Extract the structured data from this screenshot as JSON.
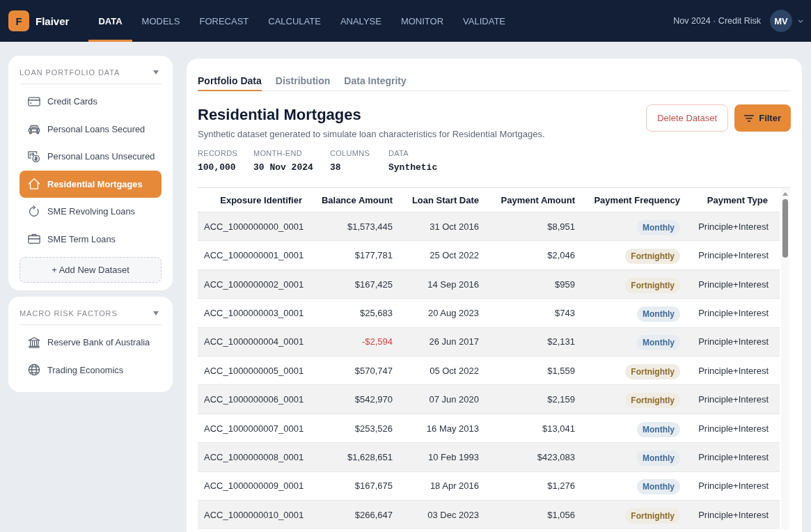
{
  "top_nav": {
    "logo": {
      "letter": "F",
      "name": "Flaiver"
    },
    "items": [
      {
        "label": "DATA",
        "selected": true
      },
      {
        "label": "MODELS",
        "selected": false
      },
      {
        "label": "FORECAST",
        "selected": false
      },
      {
        "label": "CALCULATE",
        "selected": false
      },
      {
        "label": "ANALYSE",
        "selected": false
      },
      {
        "label": "MONITOR",
        "selected": false
      },
      {
        "label": "VALIDATE",
        "selected": false
      }
    ],
    "context": "Nov 2024 · Credit Risk",
    "avatar": "MV"
  },
  "sidebar": {
    "sections": [
      {
        "title": "LOAN PORTFOLIO DATA",
        "items": [
          {
            "label": "Credit Cards",
            "kind": "card",
            "selected": false
          },
          {
            "label": "Personal Loans Secured",
            "kind": "car",
            "selected": false
          },
          {
            "label": "Personal Loans Unsecured",
            "kind": "cash",
            "selected": false
          },
          {
            "label": "Residential Mortgages",
            "kind": "house",
            "selected": true
          },
          {
            "label": "SME Revolving Loans",
            "kind": "revolving",
            "selected": false
          },
          {
            "label": "SME Term Loans",
            "kind": "briefcase",
            "selected": false
          }
        ],
        "add_button": "+ Add New Dataset"
      },
      {
        "title": "MACRO RISK FACTORS",
        "items": [
          {
            "label": "Reserve Bank of Australia",
            "kind": "bank",
            "selected": false
          },
          {
            "label": "Trading Economics",
            "kind": "globe",
            "selected": false
          }
        ]
      }
    ]
  },
  "main": {
    "tabs": [
      {
        "label": "Portfolio Data",
        "selected": true
      },
      {
        "label": "Distribution",
        "selected": false
      },
      {
        "label": "Data Integrity",
        "selected": false
      }
    ],
    "title": "Residential Mortgages",
    "description": "Synthetic dataset generated to simulate loan characteristics for Residential Mortgages.",
    "buttons": [
      {
        "label": "Delete Dataset",
        "kind": "danger"
      },
      {
        "label": "Filter",
        "kind": "filter"
      }
    ],
    "stats": [
      {
        "label": "RECORDS",
        "value": "100,000"
      },
      {
        "label": "MONTH-END",
        "value": "30 Nov 2024"
      },
      {
        "label": "COLUMNS",
        "value": "38"
      },
      {
        "label": "DATA",
        "value": "Synthetic"
      }
    ],
    "table": {
      "columns": [
        "Exposure Identifier",
        "Balance Amount",
        "Loan Start Date",
        "Payment Amount",
        "Payment Frequency",
        "Payment Type"
      ],
      "rows": [
        {
          "exposure_identifier": "ACC_1000000000_0001",
          "balance_amount": "$1,573,445",
          "balance_negative": false,
          "loan_start_date": "31 Oct 2016",
          "payment_amount": "$8,951",
          "payment_frequency": {
            "label": "Monthly",
            "color": "#3d6a99"
          },
          "payment_type": "Principle+Interest"
        },
        {
          "exposure_identifier": "ACC_1000000001_0001",
          "balance_amount": "$177,781",
          "balance_negative": false,
          "loan_start_date": "25 Oct 2022",
          "payment_amount": "$2,046",
          "payment_frequency": {
            "label": "Fortnightly",
            "color": "#8c6a2a"
          },
          "payment_type": "Principle+Interest"
        },
        {
          "exposure_identifier": "ACC_1000000002_0001",
          "balance_amount": "$167,425",
          "balance_negative": false,
          "loan_start_date": "14 Sep 2016",
          "payment_amount": "$959",
          "payment_frequency": {
            "label": "Fortnightly",
            "color": "#8c6a2a"
          },
          "payment_type": "Principle+Interest"
        },
        {
          "exposure_identifier": "ACC_1000000003_0001",
          "balance_amount": "$25,683",
          "balance_negative": false,
          "loan_start_date": "20 Aug 2023",
          "payment_amount": "$743",
          "payment_frequency": {
            "label": "Monthly",
            "color": "#3d6a99"
          },
          "payment_type": "Principle+Interest"
        },
        {
          "exposure_identifier": "ACC_1000000004_0001",
          "balance_amount": "-$2,594",
          "balance_negative": true,
          "loan_start_date": "26 Jun 2017",
          "payment_amount": "$2,131",
          "payment_frequency": {
            "label": "Monthly",
            "color": "#3d6a99"
          },
          "payment_type": "Principle+Interest"
        },
        {
          "exposure_identifier": "ACC_1000000005_0001",
          "balance_amount": "$570,747",
          "balance_negative": false,
          "loan_start_date": "05 Oct 2022",
          "payment_amount": "$1,559",
          "payment_frequency": {
            "label": "Fortnightly",
            "color": "#8c6a2a"
          },
          "payment_type": "Principle+Interest"
        },
        {
          "exposure_identifier": "ACC_1000000006_0001",
          "balance_amount": "$542,970",
          "balance_negative": false,
          "loan_start_date": "07 Jun 2020",
          "payment_amount": "$2,159",
          "payment_frequency": {
            "label": "Fortnightly",
            "color": "#8c6a2a"
          },
          "payment_type": "Principle+Interest"
        },
        {
          "exposure_identifier": "ACC_1000000007_0001",
          "balance_amount": "$253,526",
          "balance_negative": false,
          "loan_start_date": "16 May 2013",
          "payment_amount": "$13,041",
          "payment_frequency": {
            "label": "Monthly",
            "color": "#3d6a99"
          },
          "payment_type": "Principle+Interest"
        },
        {
          "exposure_identifier": "ACC_1000000008_0001",
          "balance_amount": "$1,628,651",
          "balance_negative": false,
          "loan_start_date": "10 Feb 1993",
          "payment_amount": "$423,083",
          "payment_frequency": {
            "label": "Monthly",
            "color": "#3d6a99"
          },
          "payment_type": "Principle+Interest"
        },
        {
          "exposure_identifier": "ACC_1000000009_0001",
          "balance_amount": "$167,675",
          "balance_negative": false,
          "loan_start_date": "18 Apr 2016",
          "payment_amount": "$1,276",
          "payment_frequency": {
            "label": "Monthly",
            "color": "#3d6a99"
          },
          "payment_type": "Principle+Interest"
        },
        {
          "exposure_identifier": "ACC_1000000010_0001",
          "balance_amount": "$266,647",
          "balance_negative": false,
          "loan_start_date": "03 Dec 2023",
          "payment_amount": "$1,056",
          "payment_frequency": {
            "label": "Fortnightly",
            "color": "#8c6a2a"
          },
          "payment_type": "Principle+Interest"
        }
      ]
    }
  }
}
